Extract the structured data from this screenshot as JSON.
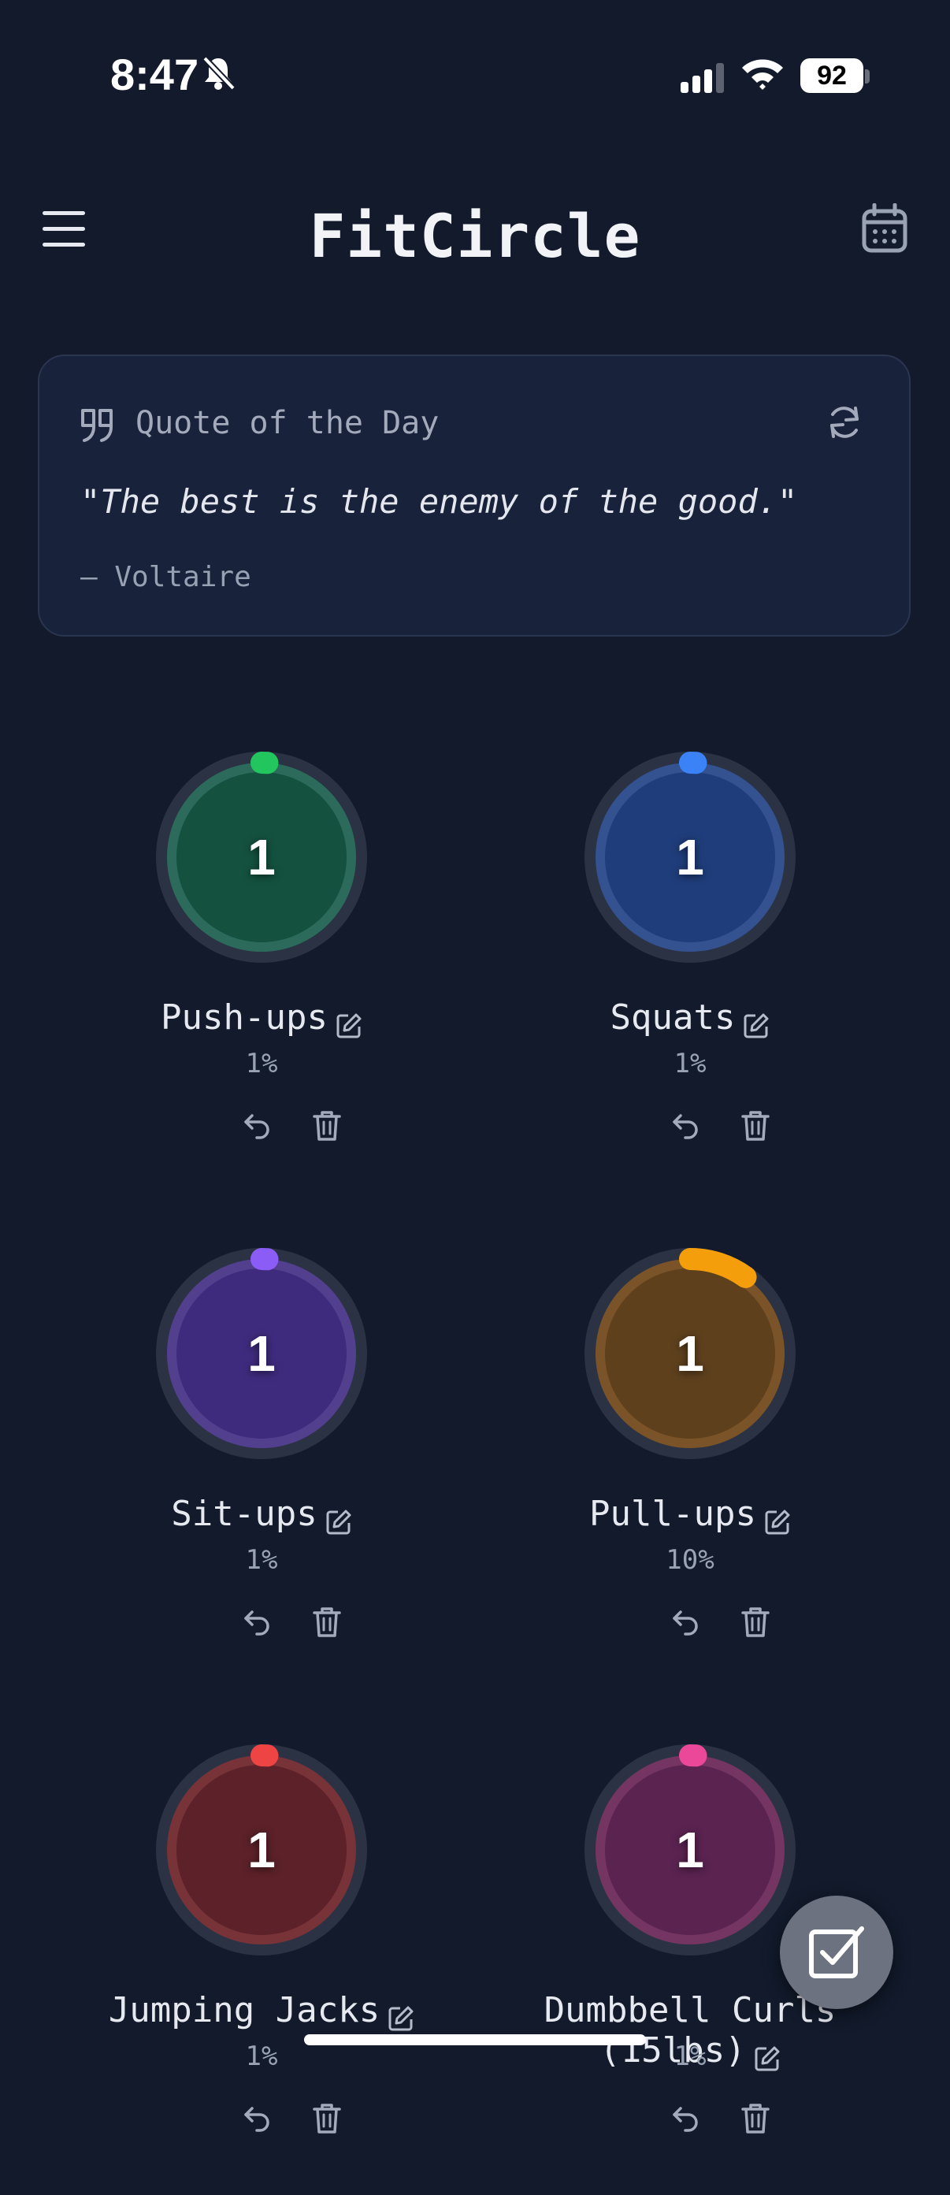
{
  "status_bar": {
    "time": "8:47",
    "battery": "92"
  },
  "header": {
    "title": "FitCircle"
  },
  "quote": {
    "label": "Quote of the Day",
    "text": "\"The best is the enemy of the good.\"",
    "author": "— Voltaire"
  },
  "exercises": [
    {
      "name": "Push-ups",
      "count": "1",
      "percent_label": "1%",
      "progress": 0.01,
      "color": "#22c55e",
      "fill": "#14513f",
      "ring": "#2c6b5b"
    },
    {
      "name": "Squats",
      "count": "1",
      "percent_label": "1%",
      "progress": 0.01,
      "color": "#3b82f6",
      "fill": "#1f3d7a",
      "ring": "#33528f"
    },
    {
      "name": "Sit-ups",
      "count": "1",
      "percent_label": "1%",
      "progress": 0.01,
      "color": "#8b5cf6",
      "fill": "#3e2b7d",
      "ring": "#52408f"
    },
    {
      "name": "Pull-ups",
      "count": "1",
      "percent_label": "10%",
      "progress": 0.1,
      "color": "#f59e0b",
      "fill": "#5e401d",
      "ring": "#7a5428"
    },
    {
      "name": "Jumping Jacks",
      "count": "1",
      "percent_label": "1%",
      "progress": 0.01,
      "color": "#ef4444",
      "fill": "#5c2129",
      "ring": "#773338"
    },
    {
      "name": "Dumbbell Curls (15lbs)",
      "count": "1",
      "percent_label": "1%",
      "progress": 0.01,
      "color": "#ec4899",
      "fill": "#5a2350",
      "ring": "#743562"
    }
  ]
}
